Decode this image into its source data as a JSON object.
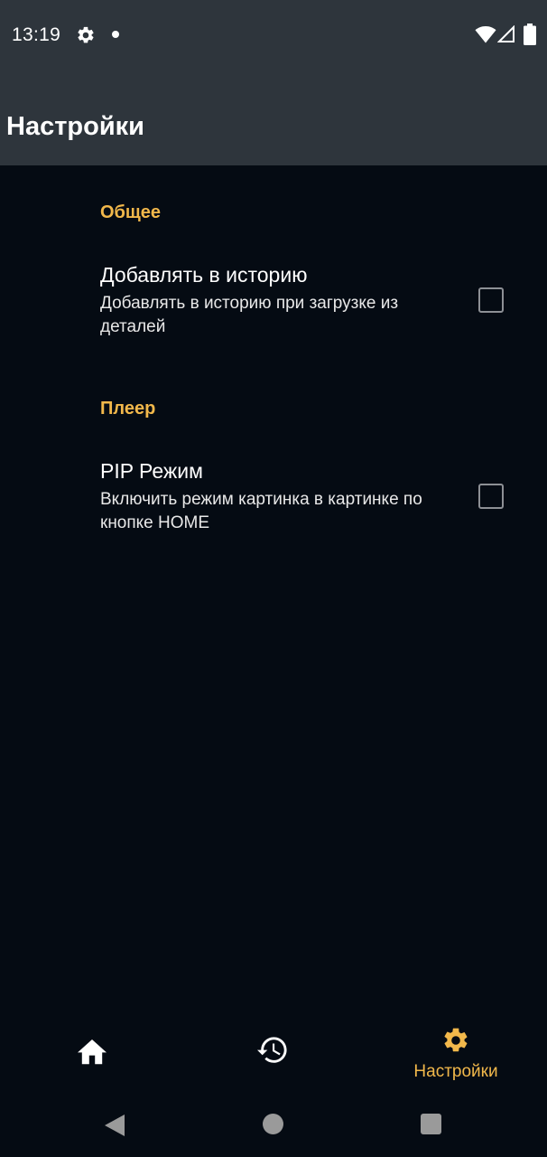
{
  "status_bar": {
    "time": "13:19",
    "icons": [
      "gear-icon",
      "notification-dot",
      "wifi-icon",
      "signal-icon",
      "battery-icon"
    ]
  },
  "app_bar": {
    "title": "Настройки"
  },
  "sections": [
    {
      "header": "Общее",
      "prefs": [
        {
          "title": "Добавлять в историю",
          "summary": "Добавлять в историю при загрузке из деталей",
          "checked": false
        }
      ]
    },
    {
      "header": "Плеер",
      "prefs": [
        {
          "title": "PIP Режим",
          "summary": "Включить режим картинка в картинке по кнопке HOME",
          "checked": false
        }
      ]
    }
  ],
  "bottom_nav": {
    "items": [
      {
        "icon": "home-icon",
        "label": "",
        "active": false
      },
      {
        "icon": "history-icon",
        "label": "",
        "active": false
      },
      {
        "icon": "gear-icon",
        "label": "Настройки",
        "active": true
      }
    ]
  },
  "colors": {
    "background": "#050b13",
    "app_bar": "#2e353c",
    "accent": "#f2b84b",
    "checkbox_border": "#8d9095"
  }
}
